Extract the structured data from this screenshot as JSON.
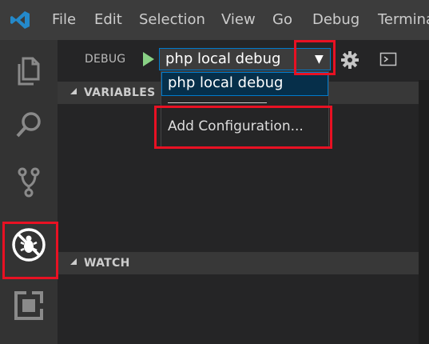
{
  "titlebar": {
    "menu": [
      "File",
      "Edit",
      "Selection",
      "View",
      "Go",
      "Debug",
      "Terminal"
    ]
  },
  "debug": {
    "label": "DEBUG",
    "configuration": "php local debug",
    "arrow": "▼"
  },
  "dropdown": {
    "selected": "php local debug",
    "add": "Add Configuration..."
  },
  "sections": {
    "variables": "VARIABLES",
    "watch": "WATCH"
  },
  "activity_icons": [
    "files-icon",
    "search-icon",
    "source-control-icon",
    "debug-icon",
    "extensions-icon"
  ],
  "colors": {
    "titlebar": "#3c3c3c",
    "activitybar": "#333333",
    "sidebar": "#252526",
    "accent": "#007acc",
    "highlight": "#e81123",
    "play": "#89d185"
  }
}
